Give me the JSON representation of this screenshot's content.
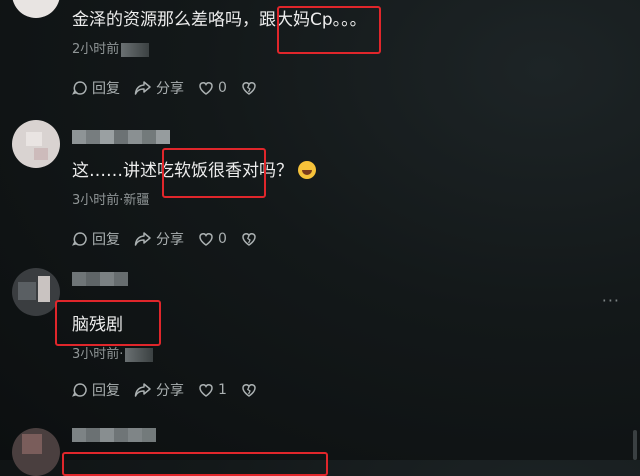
{
  "comments": [
    {
      "text": "金泽的资源那么差咯吗，跟大妈Cp。。。",
      "time": "2小时前",
      "reply": "回复",
      "share": "分享",
      "likes": "0"
    },
    {
      "text": "这……讲述吃软饭很香对吗？",
      "time": "3小时前·新疆",
      "reply": "回复",
      "share": "分享",
      "likes": "0"
    },
    {
      "text": "脑残剧",
      "time": "3小时前·",
      "reply": "回复",
      "share": "分享",
      "likes": "1"
    }
  ],
  "colors": {
    "highlight": "#e0262b",
    "background": "#131819",
    "text": "#ececec",
    "meta": "#8f9596"
  },
  "icons": [
    "reply-icon",
    "share-icon",
    "like-heart-icon",
    "dislike-broken-heart-icon",
    "laughing-emoji-icon",
    "more-dots-icon"
  ]
}
